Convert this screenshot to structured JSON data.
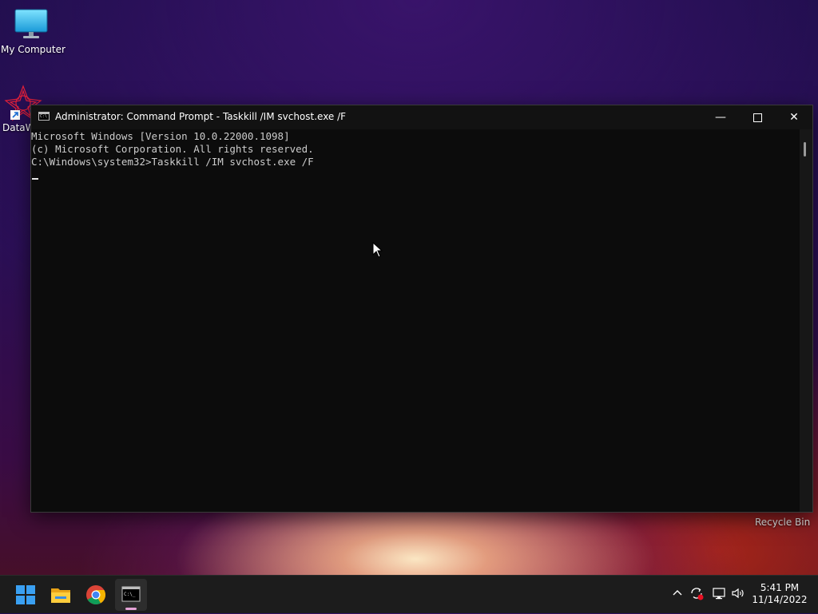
{
  "desktop": {
    "icons": [
      {
        "label": "My Computer",
        "icon": "monitor-icon"
      },
      {
        "label": "DataW",
        "icon": "datawave-shortcut-icon"
      }
    ],
    "recycle_bin_label": "Recycle Bin"
  },
  "window": {
    "title": "Administrator: Command Prompt - Taskkill  /IM svchost.exe /F",
    "console_lines": [
      "Microsoft Windows [Version 10.0.22000.1098]",
      "(c) Microsoft Corporation. All rights reserved.",
      "C:\\Windows\\system32>Taskkill /IM svchost.exe /F"
    ],
    "controls": {
      "minimize": "minimize-icon",
      "maximize": "maximize-icon",
      "close": "close-icon"
    }
  },
  "taskbar": {
    "apps": [
      "windows-start-icon",
      "file-explorer-icon",
      "chrome-icon",
      "command-prompt-icon"
    ],
    "tray_icons": [
      "chevron-up-icon",
      "sync-error-icon",
      "network-icon",
      "volume-icon"
    ],
    "time": "5:41 PM",
    "date": "11/14/2022"
  },
  "colors": {
    "console_bg": "#0c0c0c",
    "console_text": "#cccccc",
    "taskbar_bg": "#1c1c1c",
    "active_indicator": "#e6a4d8"
  }
}
